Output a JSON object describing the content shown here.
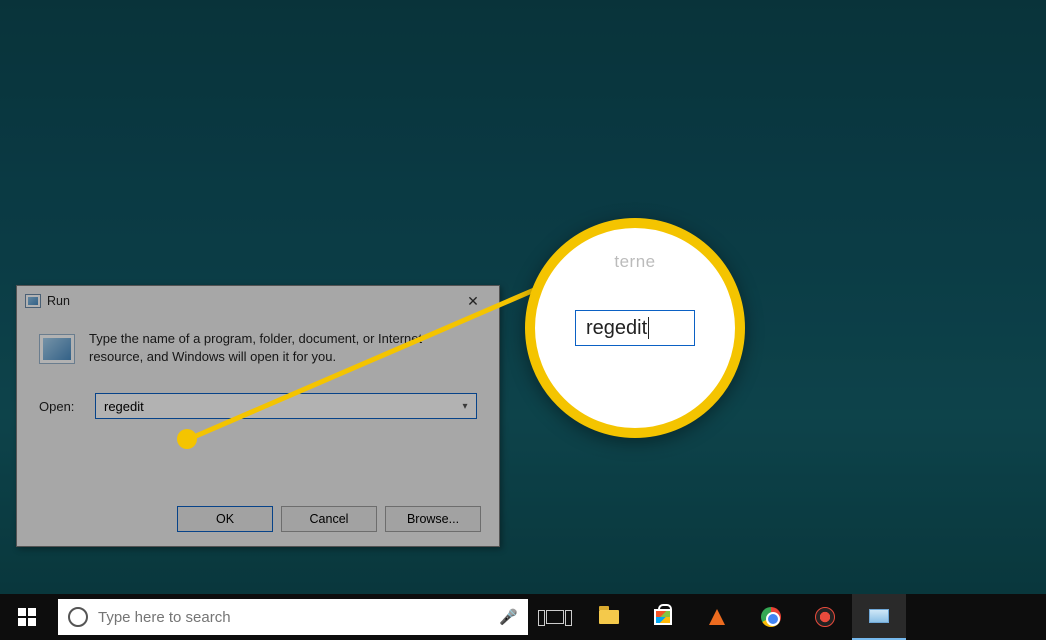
{
  "run_dialog": {
    "title": "Run",
    "close_glyph": "✕",
    "description": "Type the name of a program, folder, document, or Internet resource, and Windows will open it for you.",
    "open_label": "Open:",
    "input_value": "regedit",
    "buttons": {
      "ok": "OK",
      "cancel": "Cancel",
      "browse": "Browse..."
    }
  },
  "zoom": {
    "fragment_text": "terne",
    "value": "regedit"
  },
  "taskbar": {
    "search_placeholder": "Type here to search"
  }
}
